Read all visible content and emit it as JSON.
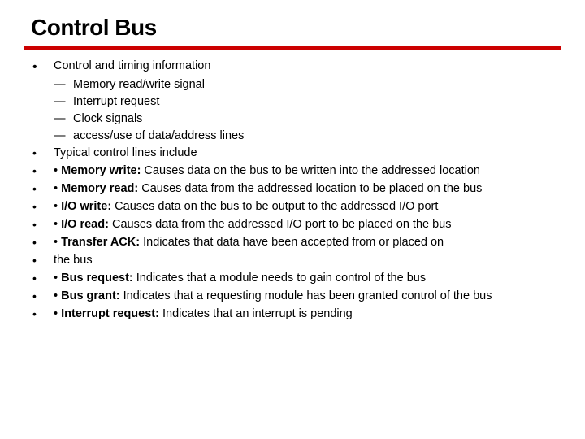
{
  "title": "Control Bus",
  "l1": "Control and timing information",
  "s1": "Memory read/write signal",
  "s2": "Interrupt request",
  "s3": "Clock signals",
  "s4": "access/use of data/address lines",
  "l2": "Typical control lines include",
  "l3a": "Memory write:",
  "l3b": " Causes data on the bus to be written into the addressed location",
  "l4a": "Memory read:",
  "l4b": " Causes data from the addressed location to be placed on the bus",
  "l5a": "I/O write:",
  "l5b": " Causes data on the bus to be output to the addressed I/O port",
  "l6a": "I/O read:",
  "l6b": " Causes data from the addressed I/O port to be placed on the bus",
  "l7a": "Transfer ACK:",
  "l7b": " Indicates that data have been accepted from or placed on",
  "l7c": "the bus",
  "l8a": "Bus request:",
  "l8b": " Indicates that a module needs to gain control of the bus",
  "l9a": "Bus grant:",
  "l9b": " Indicates that a requesting module has been granted control of the bus",
  "l10a": "Interrupt request:",
  "l10b": " Indicates that an interrupt is pending"
}
